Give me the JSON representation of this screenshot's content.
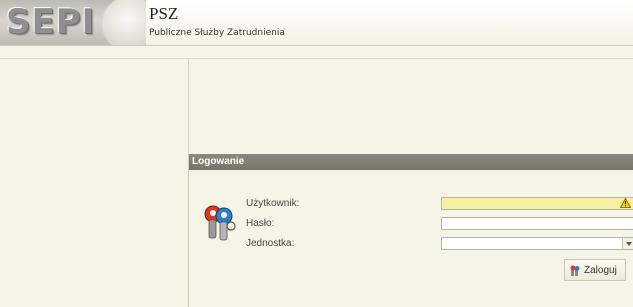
{
  "header": {
    "logo_text": "SEPI",
    "title": "PSZ",
    "subtitle": "Publiczne Służby Zatrudnienia"
  },
  "login": {
    "panel_title": "Logowanie",
    "fields": {
      "user_label": "Użytkownik:",
      "user_value": "",
      "password_label": "Hasło:",
      "password_value": "",
      "unit_label": "Jednostka:",
      "unit_value": ""
    },
    "submit_label": "Zaloguj"
  },
  "icons": {
    "keys": "keys-icon",
    "warning": "warning-icon",
    "submit": "login-icon",
    "select_arrow": "chevron-down-icon"
  },
  "colors": {
    "panel_header": "#7e7c73",
    "background": "#f6f4e6",
    "warning_field": "#f7f0a3"
  }
}
